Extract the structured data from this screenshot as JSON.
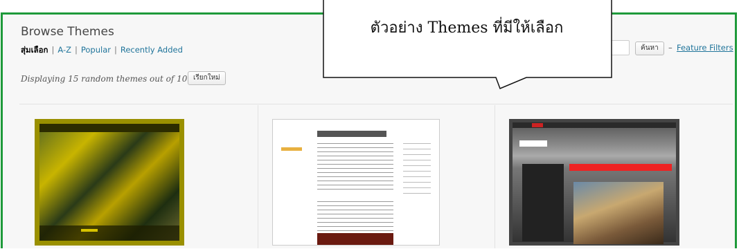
{
  "header": {
    "title": "Browse Themes"
  },
  "filters": {
    "current": "สุ่มเลือก",
    "links": [
      "A-Z",
      "Popular",
      "Recently Added"
    ],
    "separator": "|"
  },
  "status": {
    "text": "Displaying 15 random themes out of 101",
    "refresh_label": "เรียกใหม่"
  },
  "search": {
    "input_value": "",
    "button_label": "ค้นหา",
    "dash": "–",
    "feature_filters_label": "Feature Filters"
  },
  "callout": {
    "text": "ตัวอย่าง Themes ที่มีให้เลือก"
  },
  "colors": {
    "frame_border": "#1e9a3a",
    "link": "#21759b"
  },
  "themes": [
    {
      "icon": "fish-photo-theme-thumbnail"
    },
    {
      "icon": "oulipo-wordpress-theme-thumbnail"
    },
    {
      "icon": "greyzed-theme-thumbnail"
    }
  ]
}
